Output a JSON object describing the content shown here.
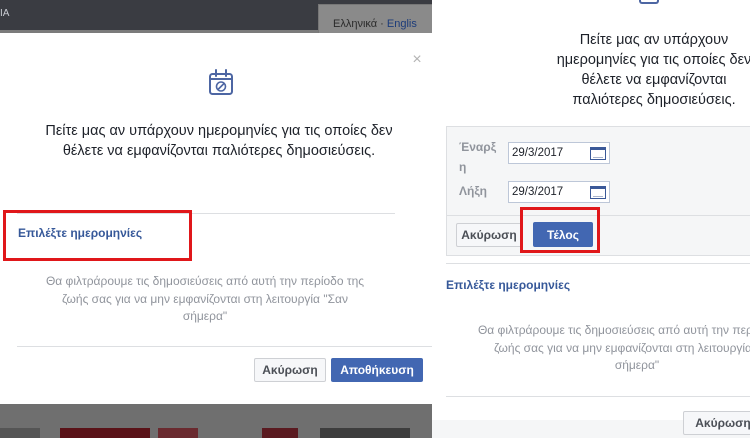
{
  "background": {
    "top_text": "ΙΑ",
    "language": {
      "current": "Ελληνικά",
      "separator": " · ",
      "other": "Englis"
    }
  },
  "left_dialog": {
    "close_symbol": "×",
    "prompt": "Πείτε μας αν υπάρχουν ημερομηνίες για τις οποίες δεν θέλετε να εμφανίζονται παλιότερες δημοσιεύσεις.",
    "choose_dates_link": "Επιλέξτε ημερομηνίες",
    "description": "Θα φιλτράρουμε τις δημοσιεύσεις από αυτή την περίοδο της ζωής σας για να μην εμφανίζονται στη λειτουργία \"Σαν σήμερα\"",
    "cancel_label": "Ακύρωση",
    "save_label": "Αποθήκευση"
  },
  "right_dialog": {
    "prompt": "Πείτε μας αν υπάρχουν ημερομηνίες για τις οποίες δεν θέλετε να εμφανίζονται παλιότερες δημοσιεύσεις.",
    "start_label_part1": "Έναρξ",
    "start_label_part2": "η",
    "start_date": "29/3/2017",
    "end_label": "Λήξη",
    "end_date": "29/3/2017",
    "cancel_label": "Ακύρωση",
    "done_label": "Τέλος",
    "choose_dates_link": "Επιλέξτε ημερομηνίες",
    "description": "Θα φιλτράρουμε τις δημοσιεύσεις από αυτή την περίοδο της ζωής σας για να μην εμφανίζονται στη λειτουργία \"Σαν σήμερα\"",
    "bottom_cancel_label": "Ακύρωση"
  },
  "colors": {
    "link": "#365899",
    "primary_button": "#4267b2",
    "highlight_box": "#e0171a",
    "muted_text": "#90949c"
  }
}
